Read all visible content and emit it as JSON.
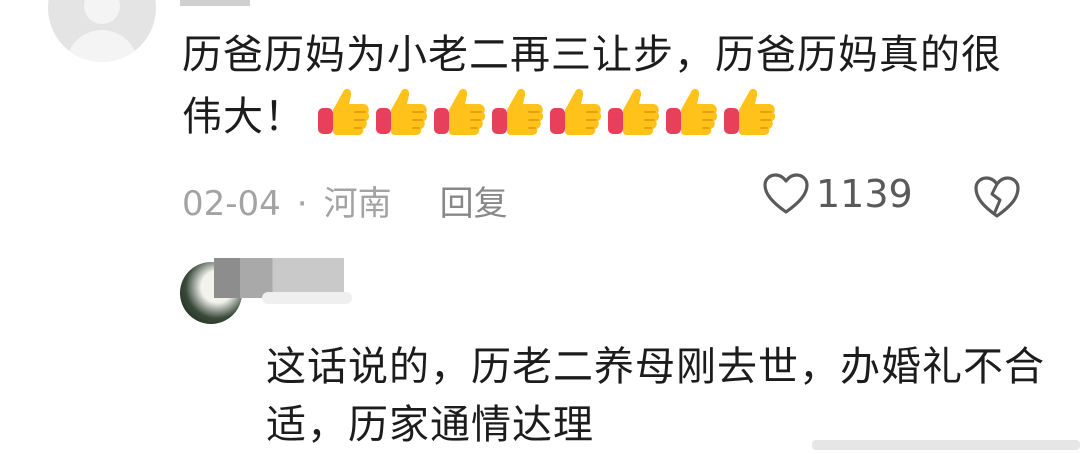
{
  "comment": {
    "text": "历爸历妈为小老二再三让步，历爸历妈真的很伟大！",
    "emoji_name": "thumbs-up-emoji",
    "emoji_count": 8,
    "date": "02-04",
    "separator": "·",
    "location": "河南",
    "reply_label": "回复",
    "like_count": "1139"
  },
  "reply": {
    "text": "这话说的，历老二养母刚去世，办婚礼不合适，历家通情达理"
  },
  "icons": {
    "like": "heart-outline-icon",
    "dislike": "broken-heart-icon"
  },
  "colors": {
    "text": "#1c1c1c",
    "meta": "#a3a3a3",
    "thumb_yellow": "#ffc21a",
    "thumb_red": "#e8405a"
  }
}
